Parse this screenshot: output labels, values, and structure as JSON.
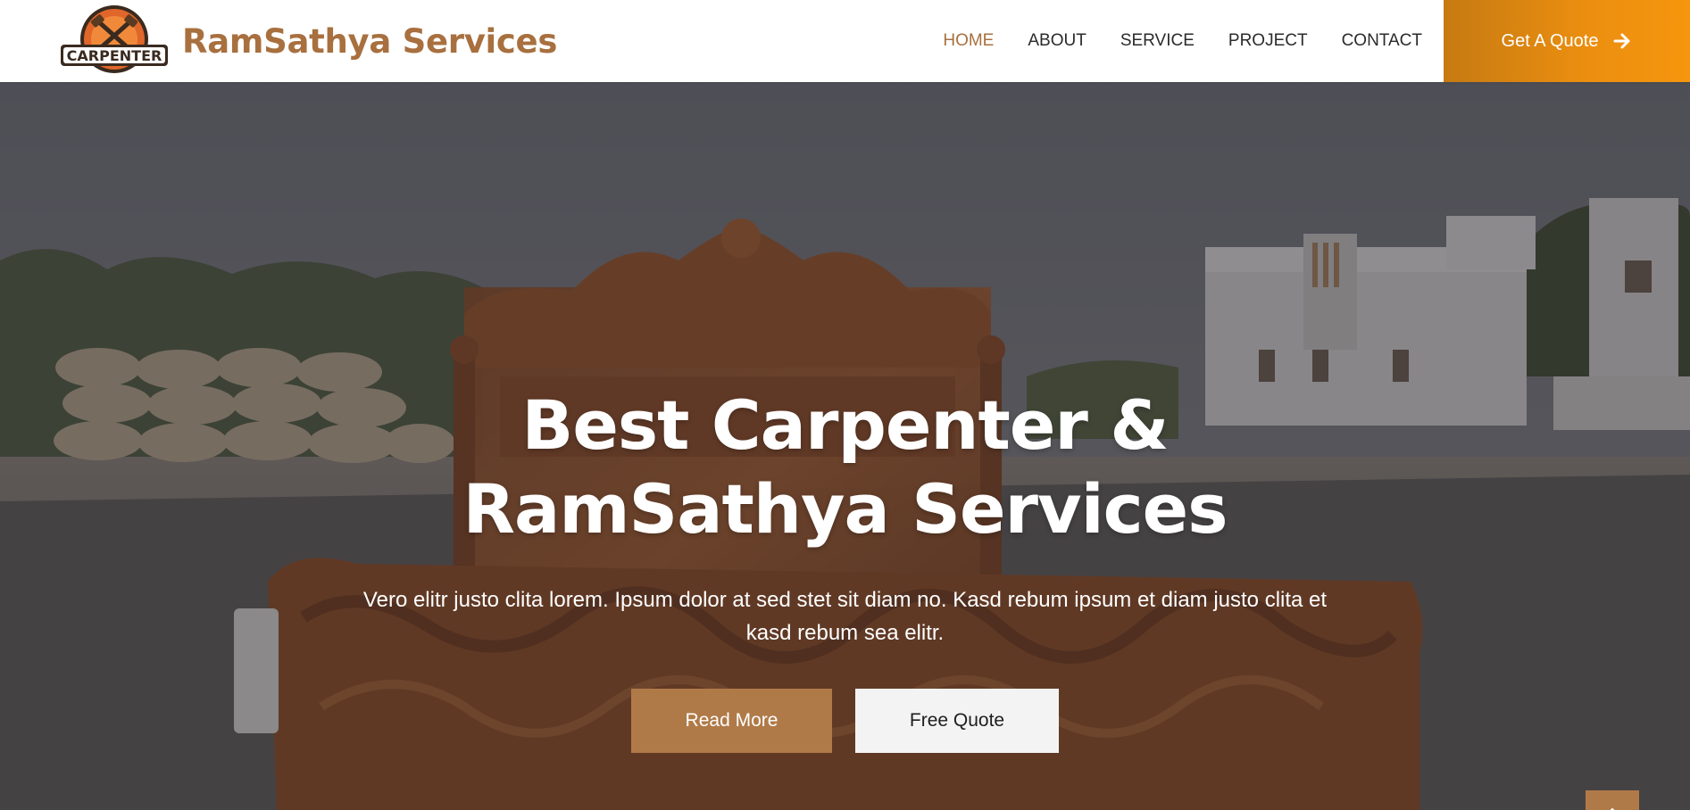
{
  "brand": {
    "logo_text": "CARPENTER",
    "name": "RamSathya Services"
  },
  "nav": {
    "items": [
      {
        "label": "HOME",
        "active": true
      },
      {
        "label": "ABOUT",
        "active": false
      },
      {
        "label": "SERVICE",
        "active": false
      },
      {
        "label": "PROJECT",
        "active": false
      },
      {
        "label": "CONTACT",
        "active": false
      }
    ],
    "quote_button": {
      "label": "Get A Quote",
      "icon": "arrow-right-icon"
    }
  },
  "hero": {
    "title": "Best Carpenter & RamSathya Services",
    "text": "Vero elitr justo clita lorem. Ipsum dolor at sed stet sit diam no. Kasd rebum ipsum et diam justo clita et kasd rebum sea elitr.",
    "buttons": {
      "read_more": "Read More",
      "free_quote": "Free Quote"
    }
  },
  "back_to_top": {
    "icon": "arrow-up-icon"
  },
  "colors": {
    "brand": "#a8703f",
    "accent_button": "#b07a48",
    "quote_gradient_start": "#c67a12",
    "quote_gradient_end": "#f6960e"
  }
}
